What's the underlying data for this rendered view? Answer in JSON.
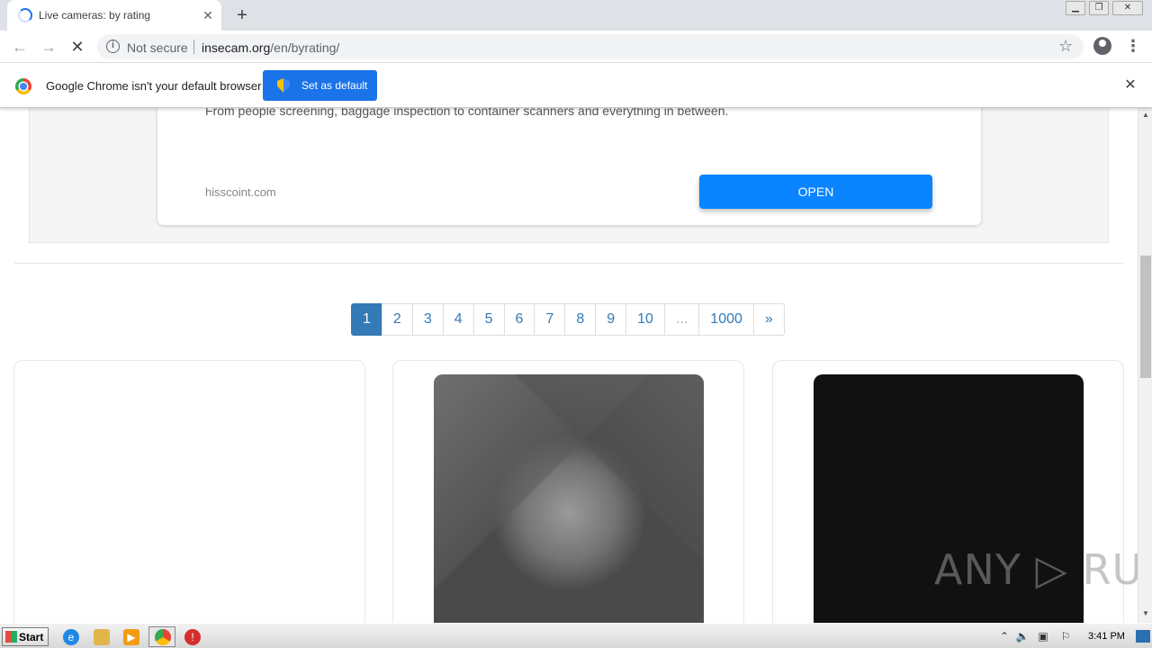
{
  "browser": {
    "tab_title": "Live cameras: by rating",
    "tab_close": "✕",
    "new_tab": "+",
    "security_label": "Not secure",
    "url_host": "insecam.org",
    "url_path": "/en/byrating/"
  },
  "infobar": {
    "message": "Google Chrome isn't your default browser",
    "set_default_label": "Set as default",
    "close": "✕"
  },
  "ad": {
    "text": "From people screening, baggage inspection to container scanners and everything in between.",
    "domain": "hisscoint.com",
    "open_label": "OPEN"
  },
  "pagination": {
    "pages": [
      "1",
      "2",
      "3",
      "4",
      "5",
      "6",
      "7",
      "8",
      "9",
      "10",
      "...",
      "1000",
      "»"
    ],
    "active": "1"
  },
  "watermark": "ANY ▷ RUN",
  "taskbar": {
    "start_label": "Start",
    "clock": "3:41 PM"
  }
}
